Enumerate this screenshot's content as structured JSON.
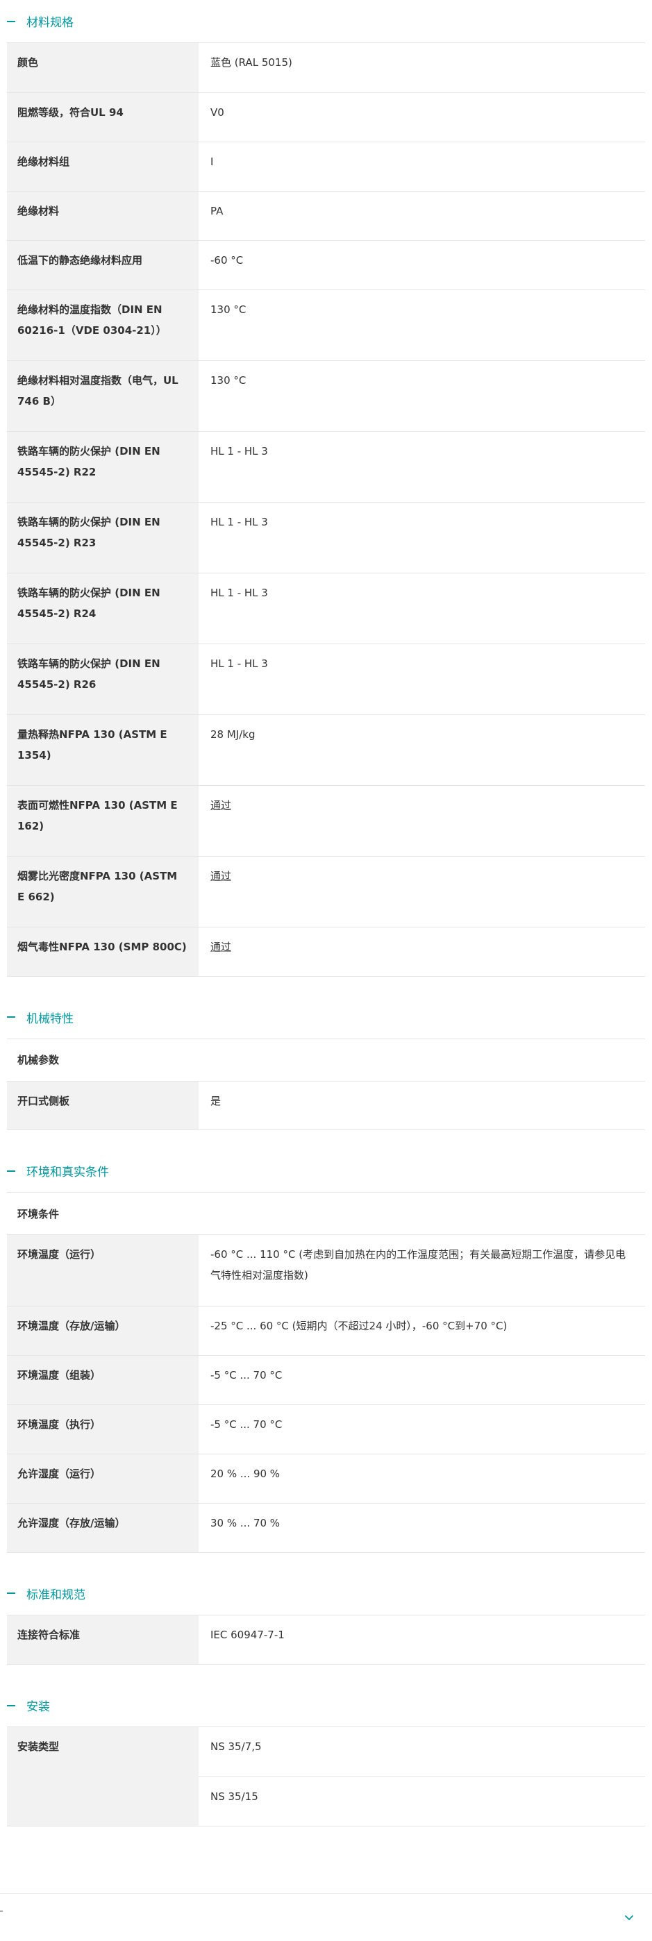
{
  "sections": {
    "material": {
      "title": "材料规格",
      "rows": [
        {
          "label": "颜色",
          "value": "蓝色 (RAL 5015)"
        },
        {
          "label": "阻燃等级，符合UL 94",
          "value": "V0"
        },
        {
          "label": "绝缘材料组",
          "value": "I"
        },
        {
          "label": "绝缘材料",
          "value": "PA"
        },
        {
          "label": "低温下的静态绝缘材料应用",
          "value": "-60 °C"
        },
        {
          "label": "绝缘材料的温度指数（DIN EN 60216-1（VDE 0304-21））",
          "value": "130 °C"
        },
        {
          "label": "绝缘材料相对温度指数（电气，UL 746 B）",
          "value": "130 °C"
        },
        {
          "label": "铁路车辆的防火保护 (DIN EN 45545-2) R22",
          "value": "HL 1 - HL 3"
        },
        {
          "label": "铁路车辆的防火保护 (DIN EN 45545-2) R23",
          "value": "HL 1 - HL 3"
        },
        {
          "label": "铁路车辆的防火保护 (DIN EN 45545-2) R24",
          "value": "HL 1 - HL 3"
        },
        {
          "label": "铁路车辆的防火保护 (DIN EN 45545-2) R26",
          "value": "HL 1 - HL 3"
        },
        {
          "label": "量热释热NFPA 130 (ASTM E 1354)",
          "value": "28 MJ/kg"
        },
        {
          "label": "表面可燃性NFPA 130 (ASTM E 162)",
          "value": "通过"
        },
        {
          "label": "烟雾比光密度NFPA 130 (ASTM E 662)",
          "value": "通过"
        },
        {
          "label": "烟气毒性NFPA 130 (SMP 800C)",
          "value": "通过"
        }
      ]
    },
    "mechanical": {
      "title": "机械特性",
      "subheading": "机械参数",
      "rows": [
        {
          "label": "开口式侧板",
          "value": "是"
        }
      ]
    },
    "environment": {
      "title": "环境和真实条件",
      "subheading": "环境条件",
      "rows": [
        {
          "label": "环境温度（运行）",
          "value": "-60 °C ... 110 °C (考虑到自加热在内的工作温度范围；有关最高短期工作温度，请参见电气特性相对温度指数)"
        },
        {
          "label": "环境温度（存放/运输）",
          "value": "-25 °C ... 60 °C (短期内（不超过24 小时），-60 °C到+70 °C)"
        },
        {
          "label": "环境温度（组装）",
          "value": "-5 °C ... 70 °C"
        },
        {
          "label": "环境温度（执行）",
          "value": "-5 °C ... 70 °C"
        },
        {
          "label": "允许湿度（运行）",
          "value": "20 % ... 90 %"
        },
        {
          "label": "允许湿度（存放/运输）",
          "value": "30 % ... 70 %"
        }
      ]
    },
    "standards": {
      "title": "标准和规范",
      "rows": [
        {
          "label": "连接符合标准",
          "value": "IEC 60947-7-1"
        }
      ]
    },
    "installation": {
      "title": "安装",
      "label": "安装类型",
      "values": [
        "NS 35/7,5",
        "NS 35/15"
      ]
    }
  },
  "icons": {
    "section_toggle": "minus-icon",
    "footer": "chevron-down-icon"
  },
  "colors": {
    "accent": "#0098a1",
    "label_bg": "#f2f2f2",
    "border": "#e5e5e5"
  }
}
